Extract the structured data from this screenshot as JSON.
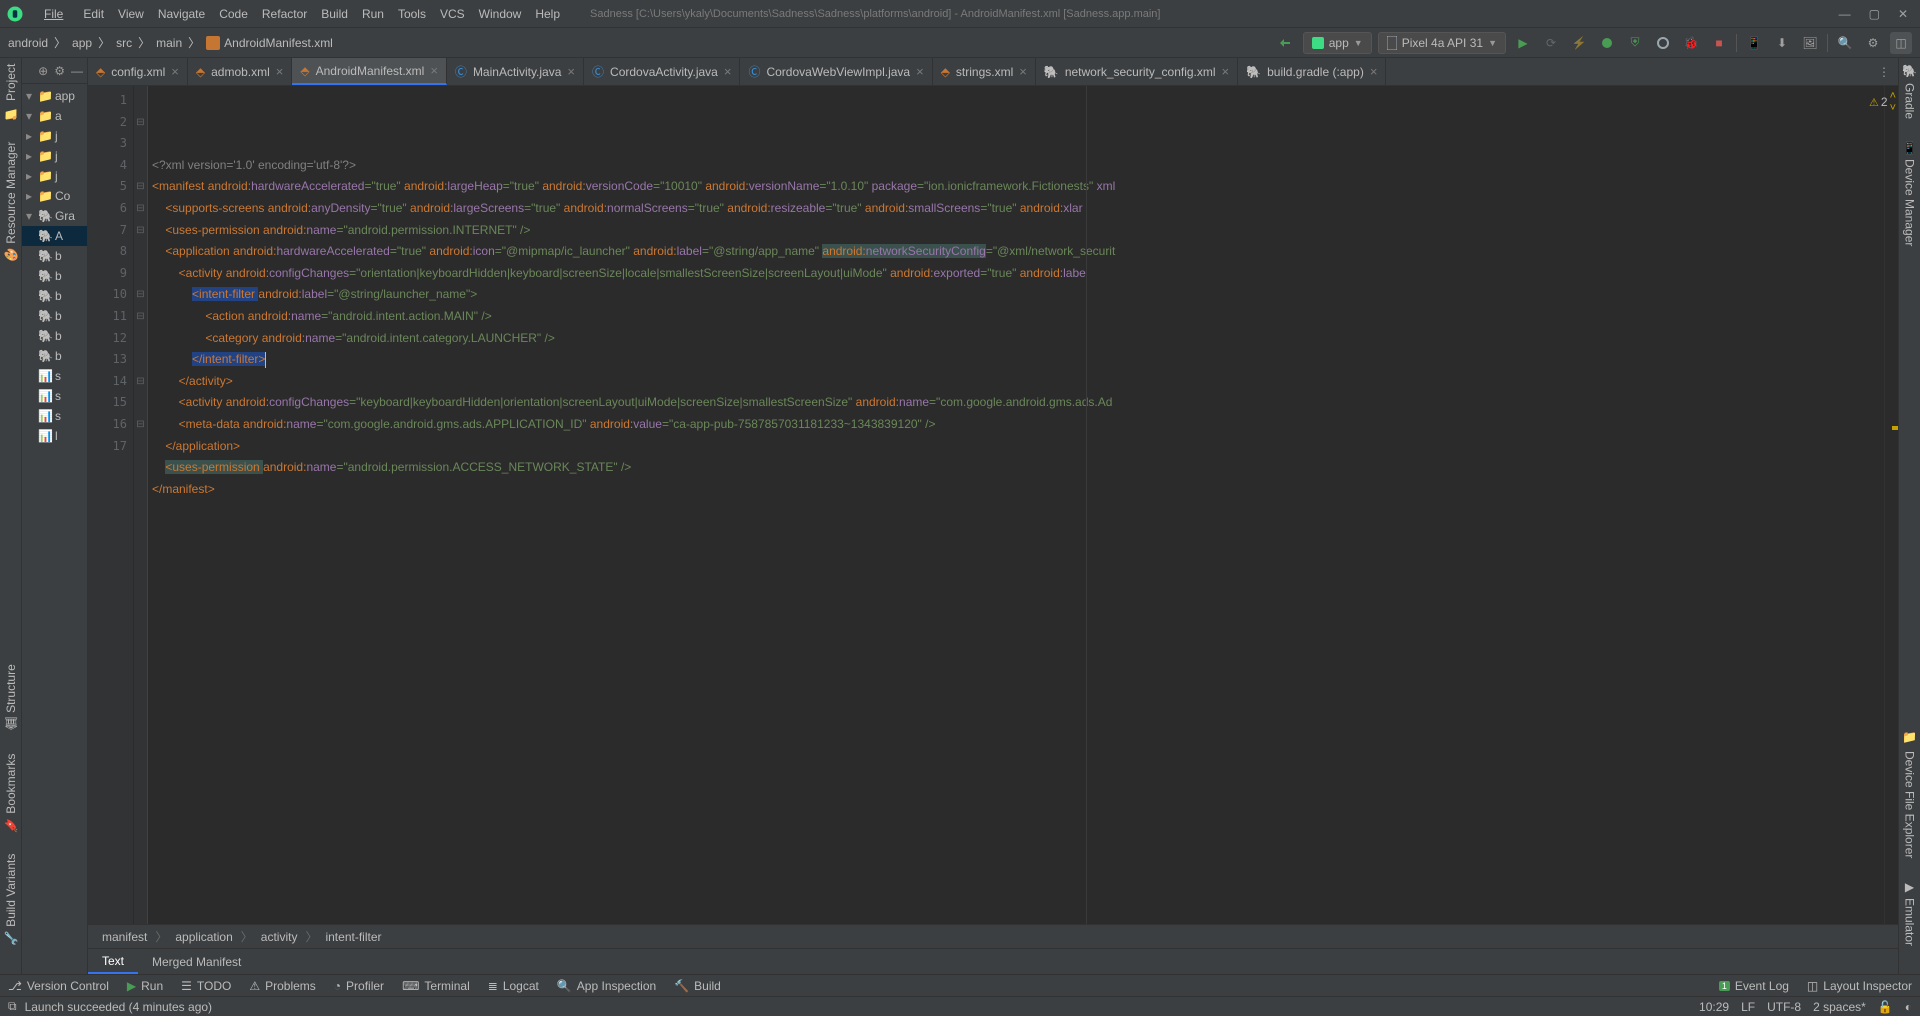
{
  "window": {
    "title": "Sadness [C:\\Users\\ykaly\\Documents\\Sadness\\Sadness\\platforms\\android] - AndroidManifest.xml [Sadness.app.main]"
  },
  "menu": [
    "File",
    "Edit",
    "View",
    "Navigate",
    "Code",
    "Refactor",
    "Build",
    "Run",
    "Tools",
    "VCS",
    "Window",
    "Help"
  ],
  "breadcrumbs": [
    "android",
    "app",
    "src",
    "main",
    "AndroidManifest.xml"
  ],
  "run_config": {
    "module": "app",
    "device": "Pixel 4a API 31"
  },
  "left_tools": [
    "Project",
    "Resource Manager",
    "Structure",
    "Bookmarks",
    "Build Variants"
  ],
  "right_tools": [
    "Gradle",
    "Device Manager",
    "Device File Explorer",
    "Emulator"
  ],
  "project_tree": {
    "root": "app",
    "children": [
      "a",
      "j",
      "j",
      "j",
      "Co",
      "Gra",
      "A",
      "b",
      "b",
      "b",
      "b",
      "b",
      "b",
      "s",
      "s",
      "s",
      "l"
    ]
  },
  "tabs": [
    {
      "label": "config.xml",
      "type": "xml"
    },
    {
      "label": "admob.xml",
      "type": "xml"
    },
    {
      "label": "AndroidManifest.xml",
      "type": "xml",
      "active": true
    },
    {
      "label": "MainActivity.java",
      "type": "java"
    },
    {
      "label": "CordovaActivity.java",
      "type": "java"
    },
    {
      "label": "CordovaWebViewImpl.java",
      "type": "java"
    },
    {
      "label": "strings.xml",
      "type": "xml"
    },
    {
      "label": "network_security_config.xml",
      "type": "xml"
    },
    {
      "label": "build.gradle (:app)",
      "type": "gradle"
    }
  ],
  "inspection": {
    "warnings": 2
  },
  "editor_crumb": [
    "manifest",
    "application",
    "activity",
    "intent-filter"
  ],
  "subtabs": [
    "Text",
    "Merged Manifest"
  ],
  "toolwins": [
    "Version Control",
    "Run",
    "TODO",
    "Problems",
    "Profiler",
    "Terminal",
    "Logcat",
    "App Inspection",
    "Build"
  ],
  "toolwins_right": [
    "Event Log",
    "Layout Inspector"
  ],
  "status": {
    "msg": "Launch succeeded (4 minutes ago)",
    "pos": "10:29",
    "le": "LF",
    "enc": "UTF-8",
    "indent": "2 spaces*"
  },
  "code": {
    "lines": 17,
    "l1": {
      "pi": "<?xml version='1.0' encoding='utf-8'?>"
    },
    "l2": {
      "a": "<manifest ",
      "b": "android:",
      "c": "hardwareAccelerated",
      "d": "=\"true\" ",
      "e": "android:",
      "f": "largeHeap",
      "g": "=\"true\" ",
      "h": "android:",
      "i": "versionCode",
      "j": "=\"10010\" ",
      "k": "android:",
      "l": "versionName",
      "m": "=\"1.0.10\" ",
      "n": "package",
      "o": "=\"ion.ionicframework.Fictionests\" ",
      "p": "xml"
    },
    "l3": {
      "a": "    <supports-screens ",
      "b": "android:",
      "c": "anyDensity",
      "d": "=\"true\" ",
      "e": "android:",
      "f": "largeScreens",
      "g": "=\"true\" ",
      "h": "android:",
      "i": "normalScreens",
      "j": "=\"true\" ",
      "k": "android:",
      "l": "resizeable",
      "m": "=\"true\" ",
      "n": "android:",
      "o": "smallScreens",
      "p": "=\"true\" ",
      "q": "android:",
      "r": "xlar"
    },
    "l4": {
      "a": "    <uses-permission ",
      "b": "android:",
      "c": "name",
      "d": "=\"android.permission.INTERNET\" />"
    },
    "l5": {
      "a": "    <application ",
      "b": "android:",
      "c": "hardwareAccelerated",
      "d": "=\"true\" ",
      "e": "android:",
      "f": "icon",
      "g": "=\"@mipmap/ic_launcher\" ",
      "h": "android:",
      "i": "label",
      "j": "=\"@string/app_name\" ",
      "k": "android:",
      "l": "networkSecurityConfig",
      "m": "=\"@xml/network_securit"
    },
    "l6": {
      "a": "        <activity ",
      "b": "android:",
      "c": "configChanges",
      "d": "=\"orientation|keyboardHidden|keyboard|screenSize|locale|smallestScreenSize|screenLayout|uiMode\" ",
      "e": "android:",
      "f": "exported",
      "g": "=\"true\" ",
      "h": "android:",
      "i": "labe"
    },
    "l7": {
      "a": "            ",
      "b": "<intent-filter ",
      "c": "android:",
      "d": "label",
      "e": "=\"@string/launcher_name\">"
    },
    "l8": {
      "a": "                <action ",
      "b": "android:",
      "c": "name",
      "d": "=\"android.intent.action.MAIN\" />"
    },
    "l9": {
      "a": "                <category ",
      "b": "android:",
      "c": "name",
      "d": "=\"android.intent.category.LAUNCHER\" />"
    },
    "l10": {
      "a": "            ",
      "b": "</intent-filter>"
    },
    "l11": {
      "a": "        </activity>"
    },
    "l12": {
      "a": "        <activity ",
      "b": "android:",
      "c": "configChanges",
      "d": "=\"keyboard|keyboardHidden|orientation|screenLayout|uiMode|screenSize|smallestScreenSize\" ",
      "e": "android:",
      "f": "name",
      "g": "=\"com.google.android.gms.ads.Ad"
    },
    "l13": {
      "a": "        <meta-data ",
      "b": "android:",
      "c": "name",
      "d": "=\"com.google.android.gms.ads.APPLICATION_ID\" ",
      "e": "android:",
      "f": "value",
      "g": "=\"ca-app-pub-7587857031181233~1343839120\" />"
    },
    "l14": {
      "a": "    </application>"
    },
    "l15": {
      "a": "    ",
      "b": "<uses-permission ",
      "c": "android:",
      "d": "name",
      "e": "=\"android.permission.ACCESS_NETWORK_STATE\" />"
    },
    "l16": {
      "a": "</manifest>"
    }
  }
}
